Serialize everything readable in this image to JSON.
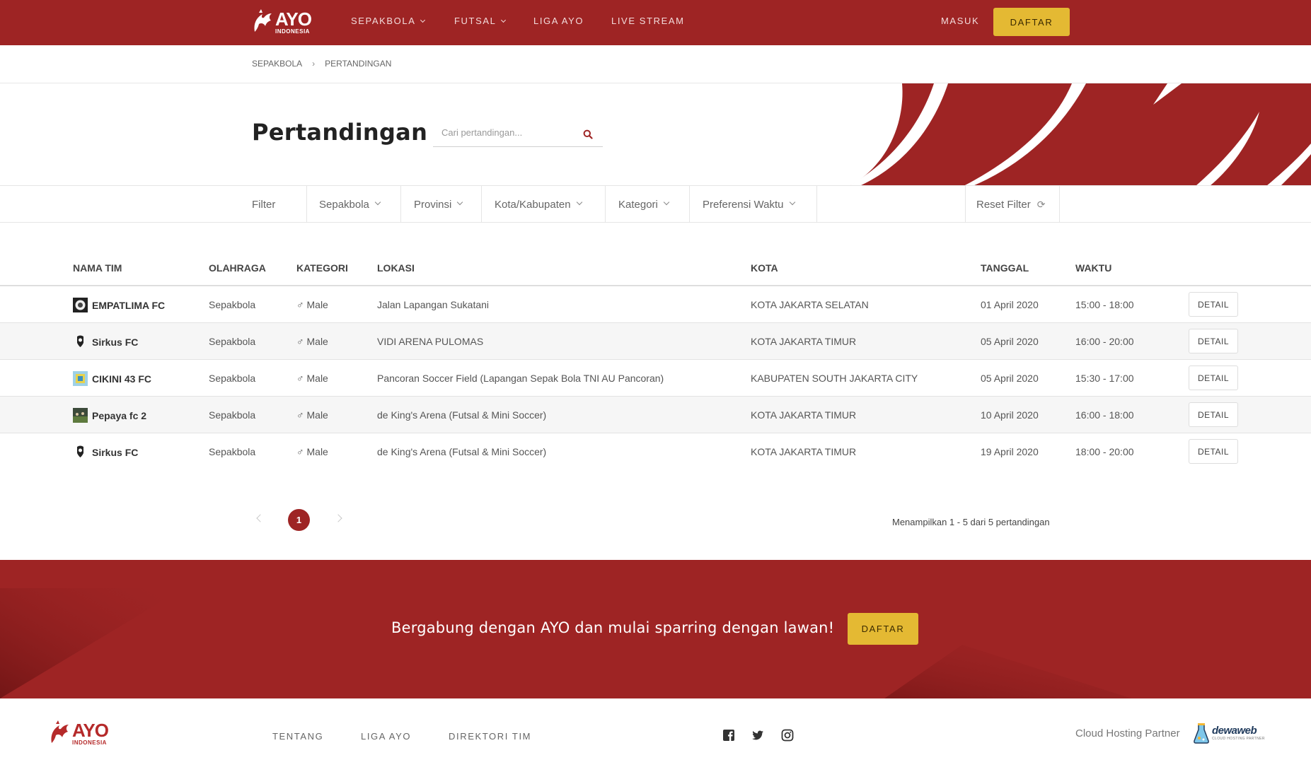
{
  "brand": {
    "name": "AYO",
    "sub": "INDONESIA"
  },
  "nav": {
    "items": [
      {
        "label": "SEPAKBOLA"
      },
      {
        "label": "FUTSAL"
      },
      {
        "label": "LIGA AYO"
      },
      {
        "label": "LIVE STREAM"
      }
    ],
    "masuk": "MASUK",
    "daftar": "DAFTAR"
  },
  "breadcrumb": [
    "SEPAKBOLA",
    "PERTANDINGAN"
  ],
  "page": {
    "title": "Pertandingan",
    "search_placeholder": "Cari pertandingan..."
  },
  "filters": {
    "label": "Filter",
    "items": [
      "Sepakbola",
      "Provinsi",
      "Kota/Kabupaten",
      "Kategori",
      "Preferensi Waktu"
    ],
    "reset": "Reset Filter"
  },
  "table": {
    "headers": [
      "NAMA TIM",
      "OLAHRAGA",
      "KATEGORI",
      "LOKASI",
      "KOTA",
      "TANGGAL",
      "WAKTU"
    ],
    "detail_label": "DETAIL",
    "rows": [
      {
        "team": "EMPATLIMA FC",
        "sport": "Sepakbola",
        "category": "Male",
        "location": "Jalan Lapangan Sukatani",
        "city": "KOTA JAKARTA SELATAN",
        "date": "01 April 2020",
        "time": "15:00 - 18:00"
      },
      {
        "team": "Sirkus FC",
        "sport": "Sepakbola",
        "category": "Male",
        "location": "VIDI ARENA PULOMAS",
        "city": "KOTA JAKARTA TIMUR",
        "date": "05 April 2020",
        "time": "16:00 - 20:00"
      },
      {
        "team": "CIKINI 43 FC",
        "sport": "Sepakbola",
        "category": "Male",
        "location": "Pancoran Soccer Field (Lapangan Sepak Bola TNI AU Pancoran)",
        "city": "KABUPATEN SOUTH JAKARTA CITY",
        "date": "05 April 2020",
        "time": "15:30 - 17:00"
      },
      {
        "team": "Pepaya fc 2",
        "sport": "Sepakbola",
        "category": "Male",
        "location": "de King's Arena (Futsal & Mini Soccer)",
        "city": "KOTA JAKARTA TIMUR",
        "date": "10 April 2020",
        "time": "16:00 - 18:00"
      },
      {
        "team": "Sirkus FC",
        "sport": "Sepakbola",
        "category": "Male",
        "location": "de King's Arena (Futsal & Mini Soccer)",
        "city": "KOTA JAKARTA TIMUR",
        "date": "19 April 2020",
        "time": "18:00 - 20:00"
      }
    ]
  },
  "pagination": {
    "current": "1",
    "info": "Menampilkan 1 - 5 dari 5 pertandingan"
  },
  "cta": {
    "text": "Bergabung dengan AYO dan mulai sparring dengan lawan!",
    "button": "DAFTAR"
  },
  "footer": {
    "links": [
      "TENTANG",
      "LIGA AYO",
      "DIREKTORI TIM"
    ],
    "social": [
      "facebook-icon",
      "twitter-icon",
      "instagram-icon"
    ],
    "partner_label": "Cloud Hosting Partner",
    "partner_name": "dewaweb",
    "partner_tagline": "CLOUD HOSTING PARTNER"
  },
  "colors": {
    "brand_red": "#9e2424",
    "accent_yellow": "#e4b933"
  }
}
